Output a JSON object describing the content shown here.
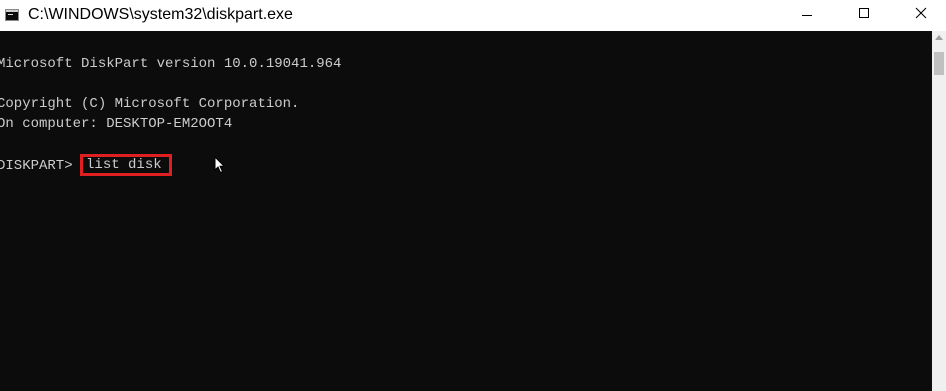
{
  "window": {
    "title": "C:\\WINDOWS\\system32\\diskpart.exe",
    "icon": "console-app-icon",
    "controls": [
      "minimize-icon",
      "maximize-icon",
      "close-icon"
    ]
  },
  "console": {
    "version_line": "Microsoft DiskPart version 10.0.19041.964",
    "copyright_line": "Copyright (C) Microsoft Corporation.",
    "computer_line": "On computer: DESKTOP-EM2OOT4",
    "prompt": "DISKPART> ",
    "command": "list disk",
    "highlight_color": "#e02020",
    "text_color": "#cccccc",
    "background_color": "#0c0c0c"
  }
}
